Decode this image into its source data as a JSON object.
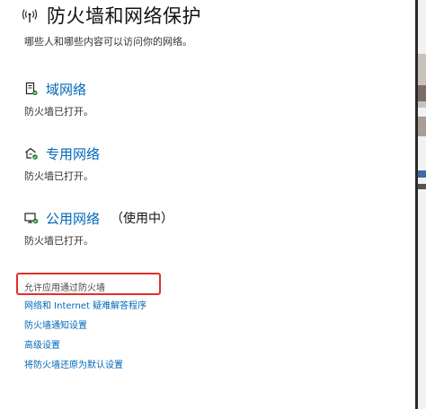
{
  "header": {
    "icon": "antenna-signal-icon",
    "title": "防火墙和网络保护",
    "subtitle": "哪些人和哪些内容可以访问你的网络。"
  },
  "networks": [
    {
      "icon": "domain-network-icon",
      "label": "域网络",
      "suffix": "",
      "status": "防火墙已打开。"
    },
    {
      "icon": "private-network-icon",
      "label": "专用网络",
      "suffix": "",
      "status": "防火墙已打开。"
    },
    {
      "icon": "public-network-icon",
      "label": "公用网络",
      "suffix": "（使用中）",
      "status": "防火墙已打开。"
    }
  ],
  "allow_app": "允许应用通过防火墙",
  "links": [
    "网络和 Internet 疑难解答程序",
    "防火墙通知设置",
    "高级设置",
    "将防火墙还原为默认设置"
  ],
  "colors": {
    "accent": "#0067b8",
    "highlight": "#e0302a"
  }
}
